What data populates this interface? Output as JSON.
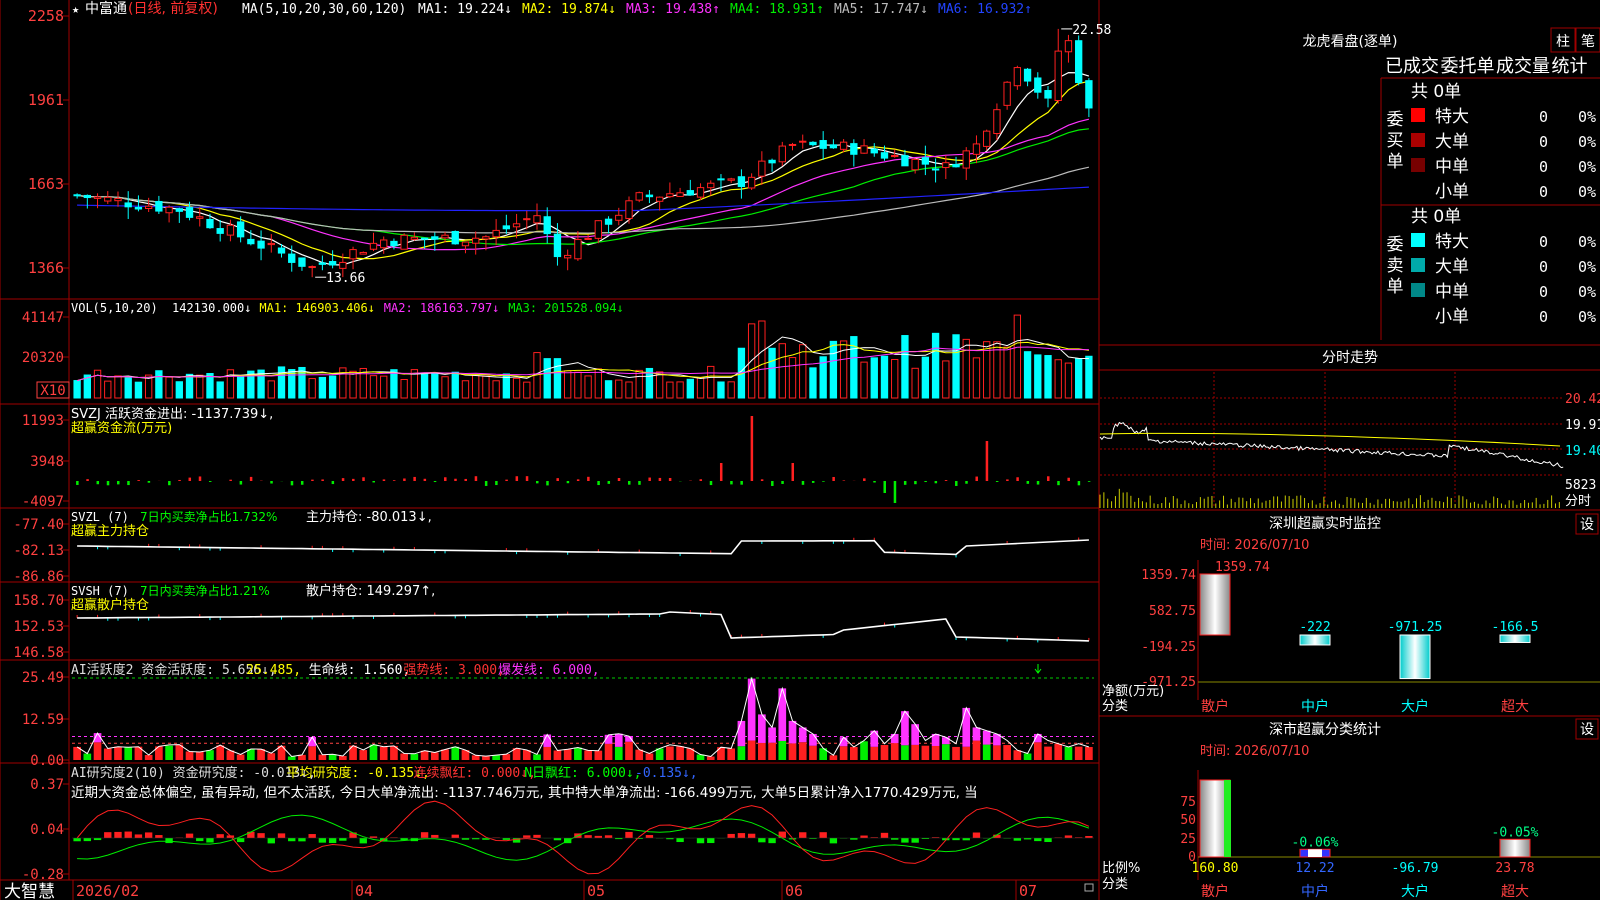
{
  "stock_name": "中富通",
  "period_label": "(日线, 前复权)",
  "colors": {
    "up": "#ff2020",
    "down": "#00ffff",
    "grid": "#a00000",
    "ma_white": "#ffffff",
    "ma_yellow": "#ffff00",
    "ma_magenta": "#ff33ff",
    "ma_green": "#00ee00",
    "ma_gray": "#bbbbbb",
    "ma_blue": "#2222ff"
  },
  "main": {
    "ma_params": "MA(5,10,20,30,60,120)",
    "ma_values": [
      {
        "label": "MA1: 19.224↓",
        "color": "#ffffff"
      },
      {
        "label": "MA2: 19.874↓",
        "color": "#ffff00"
      },
      {
        "label": "MA3: 19.438↑",
        "color": "#ff33ff"
      },
      {
        "label": "MA4: 18.931↑",
        "color": "#00ee00"
      },
      {
        "label": "MA5: 17.747↓",
        "color": "#bbbbbb"
      },
      {
        "label": "MA6: 16.932↑",
        "color": "#2244ff"
      }
    ],
    "yticks": [
      "2258",
      "1961",
      "1663",
      "1366"
    ],
    "high_label": "22.58",
    "low_label": "13.66"
  },
  "vol": {
    "params": "VOL(5,10,20)",
    "labels": [
      {
        "label": "142130.000↓",
        "color": "#ffffff"
      },
      {
        "label": "MA1: 146903.406↓",
        "color": "#ffff00"
      },
      {
        "label": "MA2: 186163.797↓",
        "color": "#ff33ff"
      },
      {
        "label": "MA3: 201528.094↓",
        "color": "#00ee00"
      }
    ],
    "yticks": [
      "41147",
      "20320"
    ],
    "unit": "X10"
  },
  "svzj": {
    "line1": "SVZJ  活跃资金进出: -1137.739↓,",
    "line2": "超赢资金流(万元)",
    "yticks": [
      "11993",
      "3948",
      "-4097"
    ]
  },
  "svzl": {
    "l1": "SVZL (7)",
    "l2": "7日内买卖净占比1.732%",
    "l3": "主力持仓: -80.013↓,",
    "line2": "超赢主力持仓",
    "yticks": [
      "-77.40",
      "-82.13",
      "-86.86"
    ]
  },
  "svsh": {
    "l1": "SVSH (7)",
    "l2": "7日内买卖净占比1.21%",
    "l3": "散户持仓: 149.297↑,",
    "line2": "超赢散户持仓",
    "yticks": [
      "158.70",
      "152.53",
      "146.58"
    ]
  },
  "ai1": {
    "parts": [
      {
        "t": "AI活跃度2 资金活跃度: 5.656↓,",
        "c": "#dddddd"
      },
      {
        "t": "25.485,",
        "c": "#ffff00"
      },
      {
        "t": "生命线: 1.560,",
        "c": "#ffffff"
      },
      {
        "t": "强势线: 3.000,",
        "c": "#ff3333"
      },
      {
        "t": "爆发线: 6.000,",
        "c": "#ff33ff"
      }
    ],
    "yticks": [
      "25.49",
      "12.59",
      "0.00"
    ]
  },
  "ai2": {
    "parts": [
      {
        "t": "AI研究度2(10) 资金研究度: -0.013↓,",
        "c": "#dddddd"
      },
      {
        "t": "平均研究度: -0.135↓,",
        "c": "#ffff00"
      },
      {
        "t": "连续飘红: 0.000↓,",
        "c": "#ff3333"
      },
      {
        "t": "N日飘红: 6.000↓,",
        "c": "#00ff00"
      },
      {
        "t": "-0.135↓,",
        "c": "#3366ff"
      }
    ],
    "comment": "近期大资金总体偏空, 虽有异动, 但不太活跃, 今日大单净流出: -1137.746万元, 其中特大单净流出: -166.499万元, 大单5日累计净入1770.429万元, 当",
    "yticks": [
      "0.37",
      "0.04",
      "-0.28"
    ]
  },
  "xaxis": {
    "labels": [
      "2026/02",
      "04",
      "05",
      "06",
      "07"
    ],
    "brand": "大智慧"
  },
  "lhb": {
    "title": "龙虎看盘(逐单)",
    "btn1": "柱",
    "btn2": "笔",
    "tabs": [
      "已成交",
      "委托单",
      "成交量",
      "统计"
    ],
    "buy_label": "委买单",
    "sell_label": "委卖单",
    "buy_total": "共 0单",
    "sell_total": "共 0单",
    "buy_rows": [
      {
        "name": "特大",
        "v": "0",
        "p": "0%",
        "color": "#ff0000"
      },
      {
        "name": "大单",
        "v": "0",
        "p": "0%",
        "color": "#aa0000"
      },
      {
        "name": "中单",
        "v": "0",
        "p": "0%",
        "color": "#770000"
      },
      {
        "name": "小单",
        "v": "0",
        "p": "0%",
        "color": ""
      }
    ],
    "sell_rows": [
      {
        "name": "特大",
        "v": "0",
        "p": "0%",
        "color": "#00ffff"
      },
      {
        "name": "大单",
        "v": "0",
        "p": "0%",
        "color": "#00aaaa"
      },
      {
        "name": "中单",
        "v": "0",
        "p": "0%",
        "color": "#008888"
      },
      {
        "name": "小单",
        "v": "0",
        "p": "0%",
        "color": ""
      }
    ]
  },
  "intraday": {
    "title": "分时走势",
    "prices": [
      "20.42",
      "19.91",
      "19.40"
    ],
    "vol": "5823",
    "unit": "分时"
  },
  "sz_monitor": {
    "title": "深圳超赢实时监控",
    "set": "设",
    "time": "时间: 2026/07/10",
    "yticks": [
      "1359.74",
      "582.75",
      "-194.25",
      "-971.25"
    ],
    "ylabel": "净额(万元)",
    "xlabel": "分类",
    "categories": [
      "散户",
      "中户",
      "大户",
      "超大"
    ],
    "values": [
      1359.74,
      -222,
      -971.25,
      -166.5
    ],
    "value_labels": [
      "1359.74",
      "-222",
      "-971.25",
      "-166.5"
    ]
  },
  "sz_stats": {
    "title": "深市超赢分类统计",
    "set": "设",
    "time": "时间: 2026/07/10",
    "yticks": [
      "75",
      "50",
      "25",
      "0"
    ],
    "ylabel": "比例%",
    "xlabel": "分类",
    "categories": [
      "散户",
      "中户",
      "大户",
      "超大"
    ],
    "bottom_labels": [
      "160.80",
      "12.22",
      "-96.79",
      "23.78"
    ],
    "top_labels": [
      "",
      "-0.06%",
      "",
      "-0.05%"
    ],
    "values": [
      100,
      10,
      0,
      23
    ]
  }
}
